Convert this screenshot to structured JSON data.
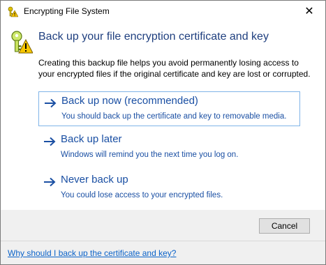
{
  "window": {
    "title": "Encrypting File System",
    "close_glyph": "✕"
  },
  "header": {
    "title": "Back up your file encryption certificate and key",
    "description": "Creating this backup file helps you avoid permanently losing access to your encrypted files if the original certificate and key are lost or corrupted."
  },
  "options": [
    {
      "label": "Back up now (recommended)",
      "sub": "You should back up the certificate and key to removable media.",
      "selected": true
    },
    {
      "label": "Back up later",
      "sub": "Windows will remind you the next time you log on.",
      "selected": false
    },
    {
      "label": "Never back up",
      "sub": "You could lose access to your encrypted files.",
      "selected": false
    }
  ],
  "footer": {
    "cancel_label": "Cancel",
    "help_link": "Why should I back up the certificate and key?"
  },
  "icons": {
    "title": "key-warning-icon",
    "header": "key-warning-icon",
    "command_arrow": "arrow-right-icon"
  },
  "colors": {
    "title_text": "#1f3f7f",
    "command_text": "#1a4fa3",
    "link": "#0b63c9",
    "selected_border": "#7fb4e8",
    "footer_bg": "#f0f0f0"
  }
}
